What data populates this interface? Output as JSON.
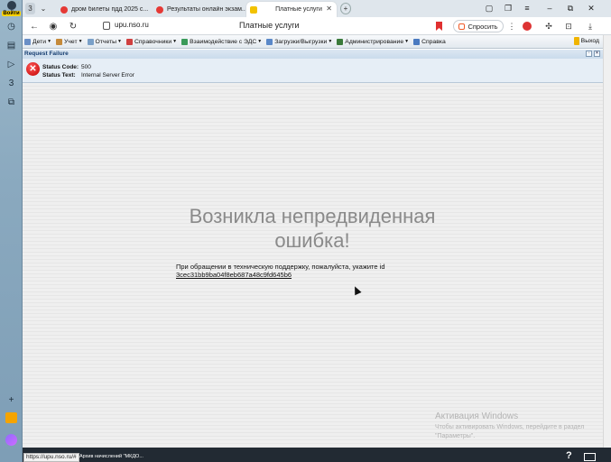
{
  "browser": {
    "login_label": "Войти",
    "sidebar_badge": "3",
    "tab_counter": "3",
    "tabs": [
      {
        "title": "дром билеты пдд 2025 с...",
        "favicon_color": "#e53935"
      },
      {
        "title": "Результаты онлайн экзам...",
        "favicon_color": "#e53935"
      },
      {
        "title": "Платные услуги",
        "favicon_color": "#f2c200",
        "active": true
      }
    ],
    "address": {
      "host": "upu.nso.ru",
      "page_title": "Платные услуги"
    },
    "ask_label": "Спросить"
  },
  "app_menu": {
    "items": [
      {
        "label": "Дети",
        "icon_color": "#6a8fc6"
      },
      {
        "label": "Учет",
        "icon_color": "#c58a3a"
      },
      {
        "label": "Отчеты",
        "icon_color": "#7aa0c8"
      },
      {
        "label": "Справочники",
        "icon_color": "#d04040"
      },
      {
        "label": "Взаимодействие с ЭДС",
        "icon_color": "#3a9a5a"
      },
      {
        "label": "Загрузки/Выгрузки",
        "icon_color": "#5a88c8"
      },
      {
        "label": "Администрирование",
        "icon_color": "#3a7a3a"
      },
      {
        "label": "Справка",
        "icon_color": "#4a7ac0"
      }
    ],
    "logout_label": "Выход"
  },
  "request_failure": {
    "header": "Request Failure",
    "status_code_label": "Status Code:",
    "status_code": "500",
    "status_text_label": "Status Text:",
    "status_text": "Internal Server Error"
  },
  "error_page": {
    "title": "Возникла непредвиденная ошибка!",
    "message": "При обращении в техническую поддержку, пожалуйста, укажите id",
    "error_id": "3cec31bb9ba04f8eb687a48c9fd645b6"
  },
  "windows_activation": {
    "title": "Активация Windows",
    "text": "Чтобы активировать Windows, перейдите в раздел \"Параметры\"."
  },
  "status_bar": {
    "url": "https://upu.nso.ru/#",
    "tab_label": "Архив начислений \"МКДО..."
  },
  "colors": {
    "accent": "#153d70",
    "error": "#c00000",
    "sidebar": "#8aa9bf"
  }
}
